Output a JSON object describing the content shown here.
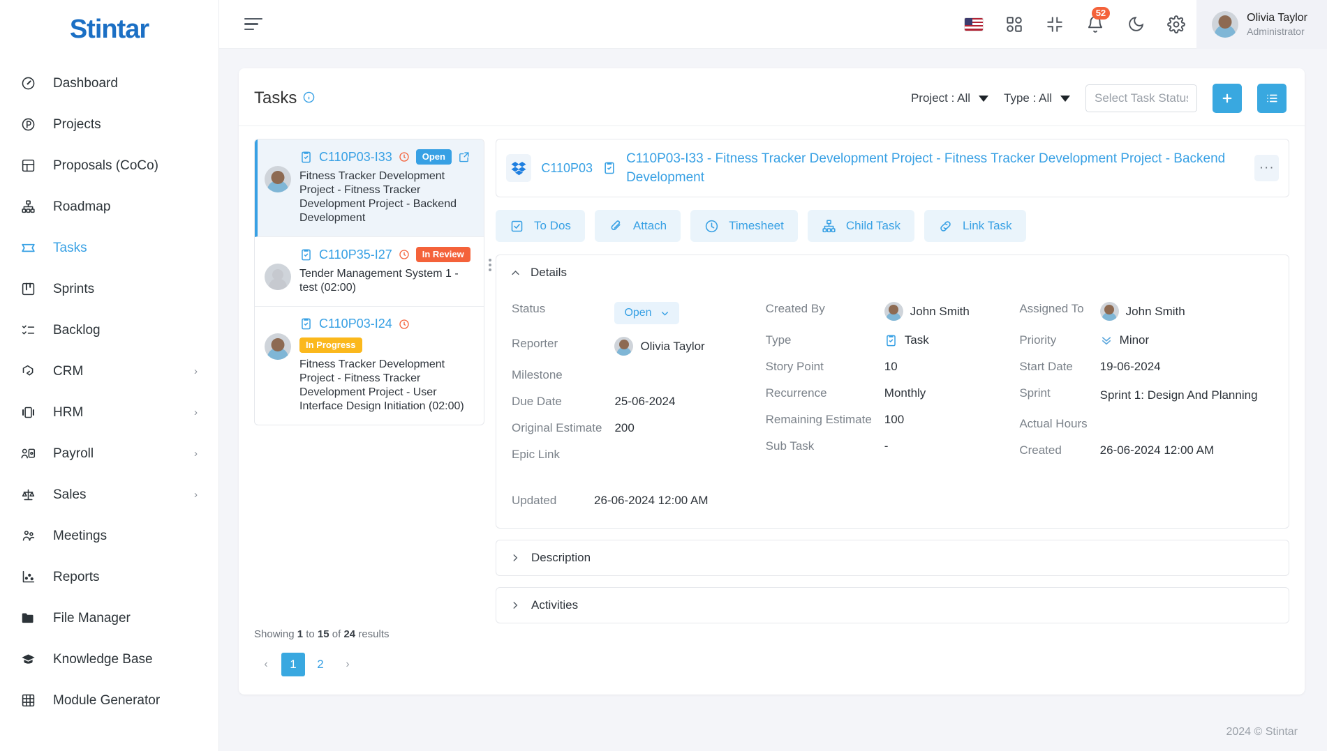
{
  "brand": {
    "name": "Stintar"
  },
  "sidebar": {
    "items": [
      {
        "label": "Dashboard",
        "icon": "gauge-icon",
        "active": false,
        "expandable": false
      },
      {
        "label": "Projects",
        "icon": "circle-p-icon",
        "active": false,
        "expandable": false
      },
      {
        "label": "Proposals (CoCo)",
        "icon": "layout-icon",
        "active": false,
        "expandable": false
      },
      {
        "label": "Roadmap",
        "icon": "hierarchy-icon",
        "active": false,
        "expandable": false
      },
      {
        "label": "Tasks",
        "icon": "tasks-icon",
        "active": true,
        "expandable": false
      },
      {
        "label": "Sprints",
        "icon": "board-icon",
        "active": false,
        "expandable": false
      },
      {
        "label": "Backlog",
        "icon": "checklist-icon",
        "active": false,
        "expandable": false
      },
      {
        "label": "CRM",
        "icon": "handshake-icon",
        "active": false,
        "expandable": true
      },
      {
        "label": "HRM",
        "icon": "id-card-icon",
        "active": false,
        "expandable": true
      },
      {
        "label": "Payroll",
        "icon": "person-money-icon",
        "active": false,
        "expandable": true
      },
      {
        "label": "Sales",
        "icon": "scales-icon",
        "active": false,
        "expandable": true
      },
      {
        "label": "Meetings",
        "icon": "people-icon",
        "active": false,
        "expandable": false
      },
      {
        "label": "Reports",
        "icon": "chart-icon",
        "active": false,
        "expandable": false
      },
      {
        "label": "File Manager",
        "icon": "folder-icon",
        "active": false,
        "expandable": false
      },
      {
        "label": "Knowledge Base",
        "icon": "graduation-cap-icon",
        "active": false,
        "expandable": false
      },
      {
        "label": "Module Generator",
        "icon": "grid-icon",
        "active": false,
        "expandable": false
      }
    ]
  },
  "topbar": {
    "menu_icon": "hamburger-icon",
    "language_flag": "us-flag-icon",
    "apps_icon": "apps-grid-icon",
    "fullscreen_icon": "collapse-screen-icon",
    "notification_icon": "bell-icon",
    "notification_count": "52",
    "theme_icon": "moon-icon",
    "settings_icon": "gear-icon",
    "user": {
      "name": "Olivia Taylor",
      "role": "Administrator"
    }
  },
  "page": {
    "title": "Tasks",
    "info_icon": "info-icon",
    "filters": [
      {
        "label": "Project : All"
      },
      {
        "label": "Type : All"
      }
    ],
    "search": {
      "placeholder": "Select Task Status",
      "value": ""
    },
    "add_button_icon": "plus-icon",
    "list_button_icon": "list-icon"
  },
  "task_list": {
    "items": [
      {
        "code": "C110P03-I33",
        "status": "Open",
        "status_kind": "open",
        "description": "Fitness Tracker Development Project - Fitness Tracker Development Project - Backend Development",
        "selected": true,
        "has_share": true,
        "avatar": "male"
      },
      {
        "code": "C110P35-I27",
        "status": "In Review",
        "status_kind": "review",
        "description": "Tender Management System 1 - test (02:00)",
        "selected": false,
        "has_share": false,
        "avatar": "plain"
      },
      {
        "code": "C110P03-I24",
        "status": "In Progress",
        "status_kind": "progress",
        "description": "Fitness Tracker Development Project - Fitness Tracker Development Project - User Interface Design Initiation (02:00)",
        "selected": false,
        "has_share": false,
        "avatar": "male"
      }
    ],
    "showing": {
      "prefix": "Showing ",
      "from": "1",
      "mid1": " to ",
      "to": "15",
      "mid2": " of ",
      "total": "24",
      "suffix": " results"
    },
    "pagination": {
      "prev": "‹",
      "pages": [
        "1",
        "2"
      ],
      "active": "1",
      "next": "›"
    }
  },
  "detail": {
    "project_icon": "dropbox-icon",
    "project_code": "C110P03",
    "task_type_icon": "task-clipboard-icon",
    "title": "C110P03-I33 - Fitness Tracker Development Project - Fitness Tracker Development Project - Backend Development",
    "more_icon": "ellipsis-icon",
    "actions": [
      {
        "label": "To Dos",
        "icon": "checkbox-icon"
      },
      {
        "label": "Attach",
        "icon": "paperclip-icon"
      },
      {
        "label": "Timesheet",
        "icon": "clock-icon"
      },
      {
        "label": "Child Task",
        "icon": "hierarchy-icon"
      },
      {
        "label": "Link Task",
        "icon": "link-icon"
      }
    ],
    "details_panel_label": "Details",
    "fields": {
      "col1": [
        {
          "label": "Status",
          "value": "Open",
          "kind": "status-chip"
        },
        {
          "label": "Reporter",
          "value": "Olivia Taylor",
          "kind": "avatar"
        },
        {
          "label": "Milestone",
          "value": "",
          "kind": "text"
        },
        {
          "label": "Due Date",
          "value": "25-06-2024",
          "kind": "text"
        },
        {
          "label": "Original Estimate",
          "value": "200",
          "kind": "text"
        },
        {
          "label": "Epic Link",
          "value": "",
          "kind": "text"
        }
      ],
      "col2": [
        {
          "label": "Created By",
          "value": "John Smith",
          "kind": "avatar"
        },
        {
          "label": "Type",
          "value": "Task",
          "kind": "task-icon"
        },
        {
          "label": "Story Point",
          "value": "10",
          "kind": "text"
        },
        {
          "label": "Recurrence",
          "value": "Monthly",
          "kind": "text"
        },
        {
          "label": "Remaining Estimate",
          "value": "100",
          "kind": "text"
        },
        {
          "label": "Sub Task",
          "value": "-",
          "kind": "text"
        }
      ],
      "col3": [
        {
          "label": "Assigned To",
          "value": "John Smith",
          "kind": "avatar"
        },
        {
          "label": "Priority",
          "value": "Minor",
          "kind": "priority"
        },
        {
          "label": "Start Date",
          "value": "19-06-2024",
          "kind": "text"
        },
        {
          "label": "Sprint",
          "value": "Sprint 1: Design And Planning",
          "kind": "text"
        },
        {
          "label": "Actual Hours",
          "value": "",
          "kind": "text"
        },
        {
          "label": "Created",
          "value": "26-06-2024 12:00 AM",
          "kind": "text"
        }
      ]
    },
    "updated": {
      "label": "Updated",
      "value": "26-06-2024 12:00 AM"
    },
    "sections": [
      {
        "label": "Description"
      },
      {
        "label": "Activities"
      }
    ]
  },
  "footer": {
    "text": "2024 © Stintar"
  },
  "colors": {
    "accent": "#37a0e4",
    "danger": "#f4623a",
    "warning": "#fbb81c",
    "sidebar_bg": "#ffffff",
    "page_bg": "#f4f5f9"
  }
}
